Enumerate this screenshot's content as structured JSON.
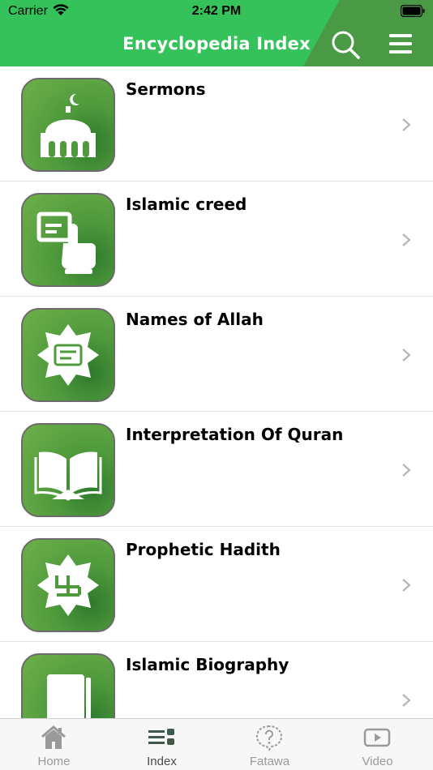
{
  "status": {
    "carrier": "Carrier",
    "time": "2:42 PM"
  },
  "header": {
    "title": "Encyclopedia Index",
    "search_icon": "search-icon",
    "menu_icon": "hamburger-menu-icon"
  },
  "colors": {
    "header_green": "#35c25a",
    "icon_green": "#4f9a3c",
    "inactive_tab": "#9a9a9a"
  },
  "items": [
    {
      "label": "Sermons",
      "icon": "mosque-icon"
    },
    {
      "label": "Islamic creed",
      "icon": "finger-point-icon"
    },
    {
      "label": "Names of Allah",
      "icon": "allah-emblem-icon"
    },
    {
      "label": "Interpretation Of Quran",
      "icon": "open-quran-icon"
    },
    {
      "label": "Prophetic Hadith",
      "icon": "hadith-emblem-icon"
    },
    {
      "label": "Islamic Biography",
      "icon": "biography-book-icon"
    }
  ],
  "tabs": [
    {
      "label": "Home",
      "icon": "home-icon",
      "active": false
    },
    {
      "label": "Index",
      "icon": "index-list-icon",
      "active": true
    },
    {
      "label": "Fatawa",
      "icon": "question-bubble-icon",
      "active": false
    },
    {
      "label": "Video",
      "icon": "video-play-icon",
      "active": false
    }
  ]
}
